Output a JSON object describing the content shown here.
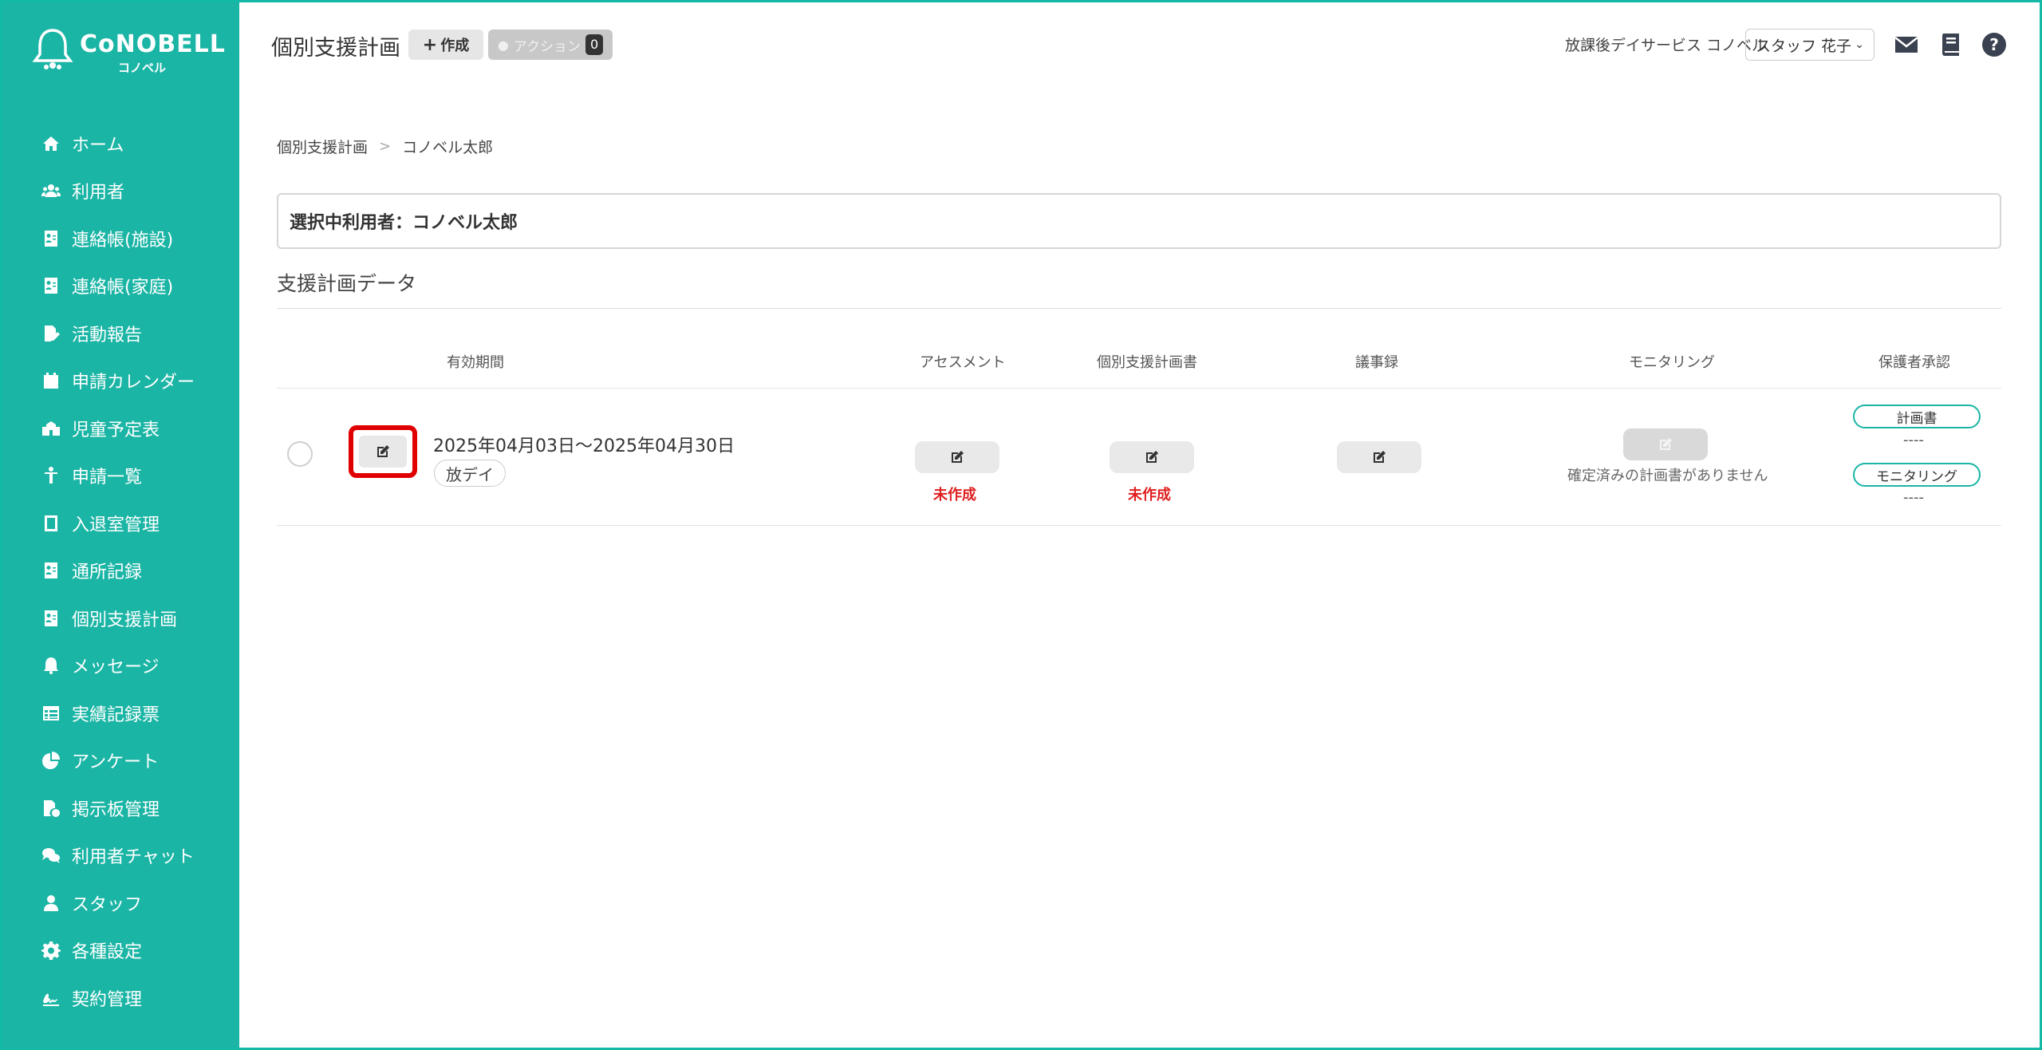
{
  "brand": {
    "logo_text": "CoNOBELL",
    "logo_sub": "コノベル"
  },
  "sidebar": {
    "items": [
      {
        "label": "ホーム",
        "icon": "home-icon"
      },
      {
        "label": "利用者",
        "icon": "users-icon"
      },
      {
        "label": "連絡帳(施設)",
        "icon": "contact-book-icon"
      },
      {
        "label": "連絡帳(家庭)",
        "icon": "contact-book-icon"
      },
      {
        "label": "活動報告",
        "icon": "file-edit-icon"
      },
      {
        "label": "申請カレンダー",
        "icon": "calendar-icon"
      },
      {
        "label": "児童予定表",
        "icon": "school-icon"
      },
      {
        "label": "申請一覧",
        "icon": "child-icon"
      },
      {
        "label": "入退室管理",
        "icon": "tablet-icon"
      },
      {
        "label": "通所記録",
        "icon": "contact-book-icon"
      },
      {
        "label": "個別支援計画",
        "icon": "contact-book-icon"
      },
      {
        "label": "メッセージ",
        "icon": "bell-icon"
      },
      {
        "label": "実績記録票",
        "icon": "table-icon"
      },
      {
        "label": "アンケート",
        "icon": "pie-chart-icon"
      },
      {
        "label": "掲示板管理",
        "icon": "file-check-icon"
      },
      {
        "label": "利用者チャット",
        "icon": "chat-icon"
      },
      {
        "label": "スタッフ",
        "icon": "staff-icon"
      },
      {
        "label": "各種設定",
        "icon": "gear-icon"
      },
      {
        "label": "契約管理",
        "icon": "signature-icon"
      }
    ]
  },
  "header": {
    "title": "個別支援計画",
    "create_label": "作成",
    "action_label": "アクション",
    "action_count": "0",
    "facility": "放課後デイサービス コノベル",
    "staff_selected": "スタッフ 花子"
  },
  "breadcrumb": {
    "root": "個別支援計画",
    "current": "コノベル太郎"
  },
  "selected_user": "選択中利用者：コノベル太郎",
  "section_title": "支援計画データ",
  "table": {
    "headers": {
      "period": "有効期間",
      "assessment": "アセスメント",
      "plan": "個別支援計画書",
      "minutes": "議事録",
      "monitoring": "モニタリング",
      "guardian": "保護者承認"
    },
    "row": {
      "period": "2025年04月03日〜2025年04月30日",
      "service": "放デイ",
      "assessment_status": "未作成",
      "plan_status": "未作成",
      "monitoring_note": "確定済みの計画書がありません",
      "guardian_plan_label": "計画書",
      "guardian_plan_value": "----",
      "guardian_monitoring_label": "モニタリング",
      "guardian_monitoring_value": "----"
    }
  },
  "colors": {
    "sidebar": "#1bb5a5",
    "highlight": "#e00000",
    "status_red": "#e02020"
  }
}
